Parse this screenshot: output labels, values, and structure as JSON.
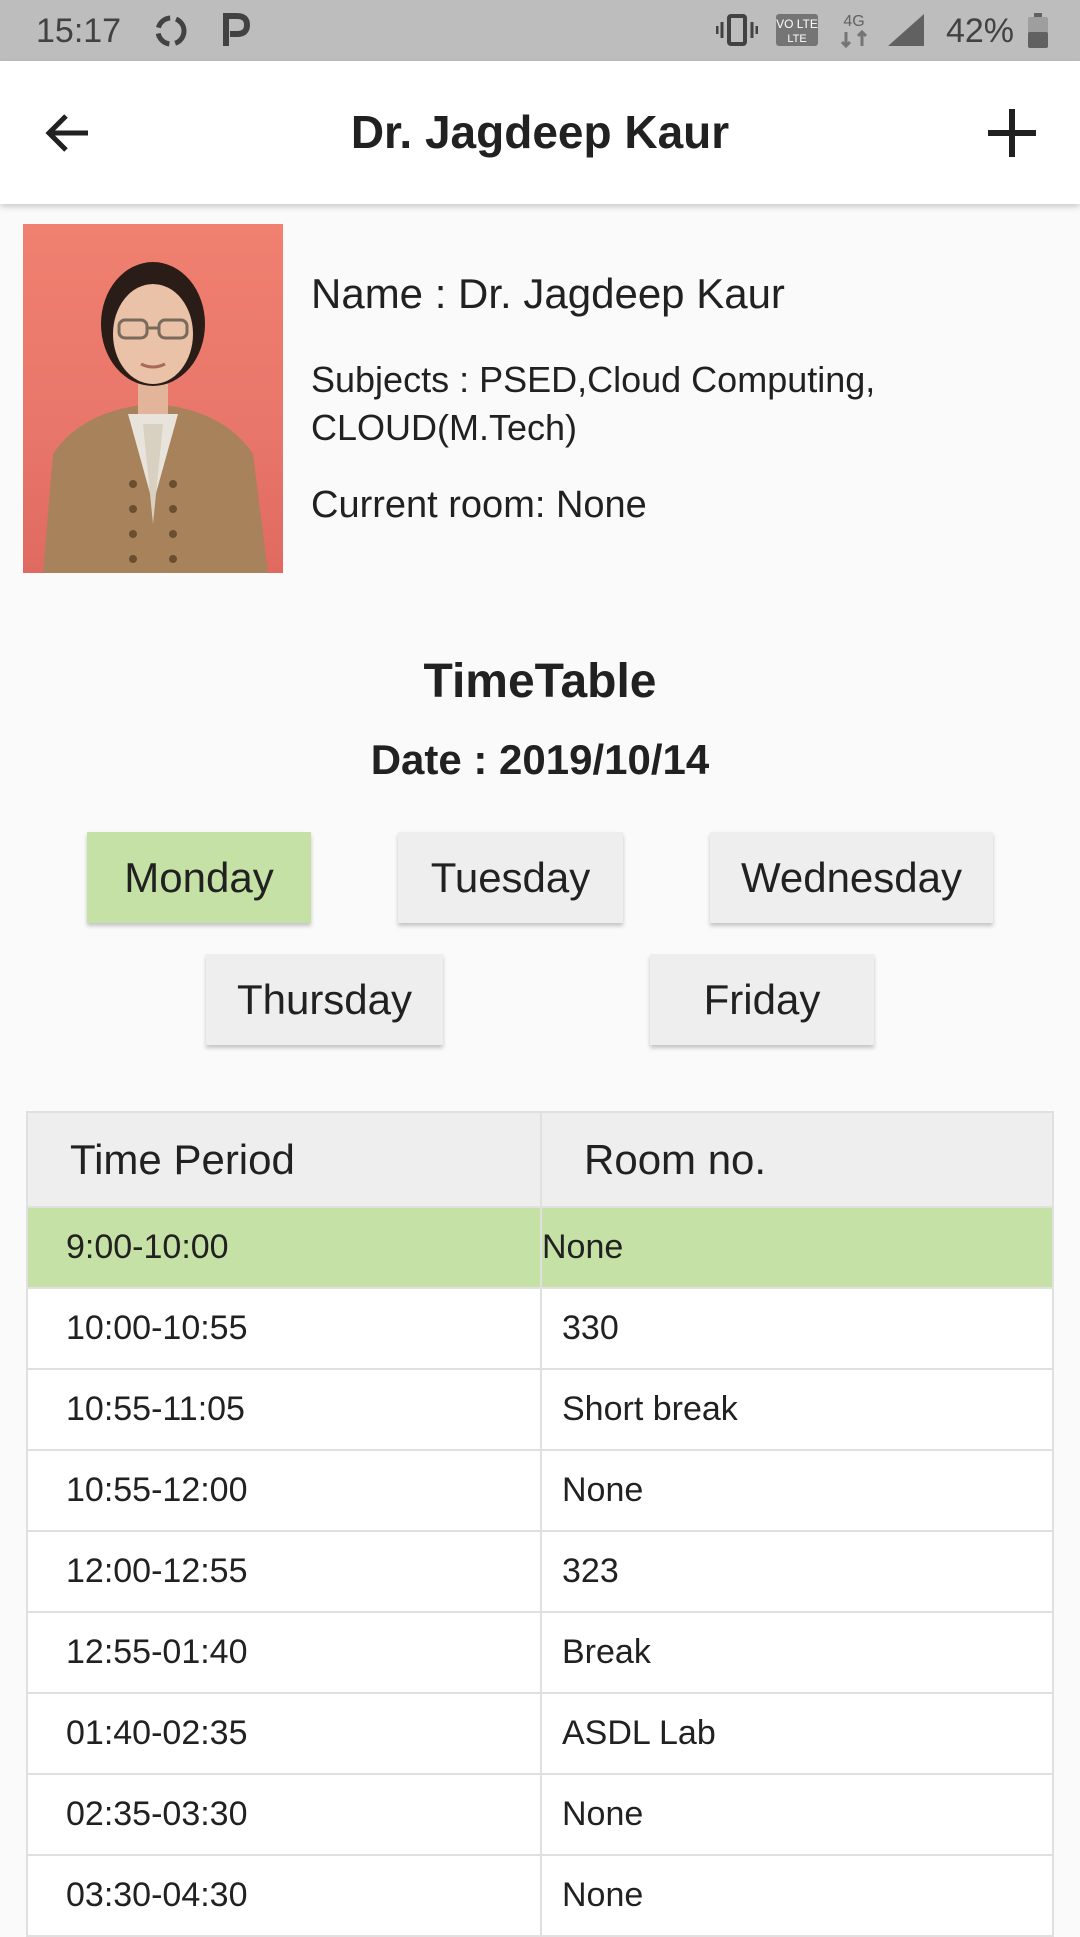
{
  "status_bar": {
    "time": "15:17",
    "battery": "42%",
    "network": "4G",
    "volte": "VO LTE",
    "icons": [
      "sync-icon",
      "p-icon",
      "vibrate-icon",
      "volte-icon",
      "network-4g-icon",
      "signal-icon",
      "battery-icon"
    ]
  },
  "app_bar": {
    "title": "Dr. Jagdeep Kaur",
    "back_icon": "arrow-back-icon",
    "add_icon": "add-icon"
  },
  "profile": {
    "name": "Name : Dr. Jagdeep Kaur",
    "subjects": "Subjects : PSED,Cloud Computing, CLOUD(M.Tech)",
    "current_room": "Current room: None"
  },
  "timetable": {
    "title": "TimeTable",
    "date": "Date : 2019/10/14",
    "days": [
      {
        "label": "Monday",
        "selected": true
      },
      {
        "label": "Tuesday",
        "selected": false
      },
      {
        "label": "Wednesday",
        "selected": false
      },
      {
        "label": "Thursday",
        "selected": false
      },
      {
        "label": "Friday",
        "selected": false
      }
    ],
    "columns": [
      "Time Period",
      "Room no."
    ],
    "rows": [
      {
        "time": "9:00-10:00",
        "room": "None",
        "current": true
      },
      {
        "time": "10:00-10:55",
        "room": "330",
        "current": false
      },
      {
        "time": "10:55-11:05",
        "room": "Short break",
        "current": false
      },
      {
        "time": "10:55-12:00",
        "room": "None",
        "current": false
      },
      {
        "time": "12:00-12:55",
        "room": "323",
        "current": false
      },
      {
        "time": "12:55-01:40",
        "room": "Break",
        "current": false
      },
      {
        "time": "01:40-02:35",
        "room": "ASDL Lab",
        "current": false
      },
      {
        "time": "02:35-03:30",
        "room": "None",
        "current": false
      },
      {
        "time": "03:30-04:30",
        "room": "None",
        "current": false
      }
    ]
  },
  "colors": {
    "accent_green": "#c5e1a5",
    "status_bar_bg": "#bdbdbd",
    "button_bg": "#eeeeee"
  }
}
